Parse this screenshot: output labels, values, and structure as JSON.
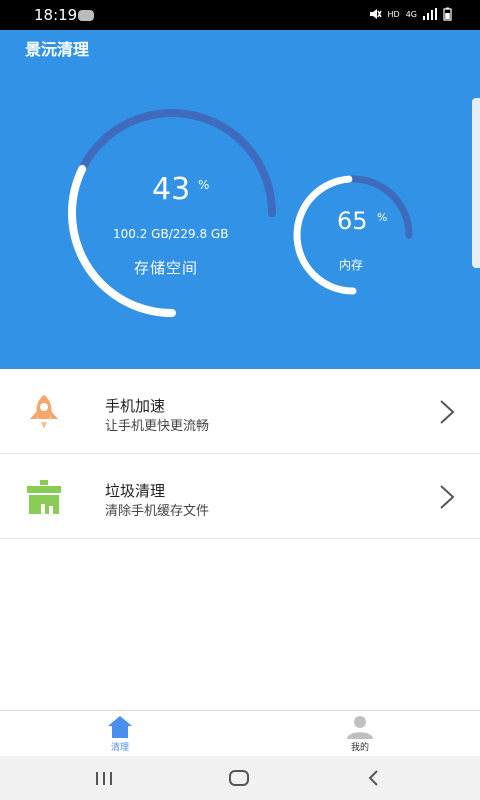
{
  "status_bar": {
    "time": "18:19",
    "network": "HD",
    "network_type": "4G"
  },
  "app": {
    "title": "景沅清理"
  },
  "storage": {
    "percent": 43,
    "percent_sign": "%",
    "size_text": "100.2 GB/229.8 GB",
    "label": "存储空间"
  },
  "memory": {
    "percent": 65,
    "percent_sign": "%",
    "label": "内存"
  },
  "features": [
    {
      "title": "手机加速",
      "subtitle": "让手机更快更流畅",
      "icon": "rocket-icon"
    },
    {
      "title": "垃圾清理",
      "subtitle": "清除手机缓存文件",
      "icon": "trash-bin-icon"
    }
  ],
  "tabs": [
    {
      "label": "清理",
      "icon": "home-icon",
      "active": true
    },
    {
      "label": "我的",
      "icon": "user-icon",
      "active": false
    }
  ],
  "colors": {
    "header_bg": "#3192e6",
    "gauge_track": "#3f6bbf",
    "active_tab": "#4a8ef0",
    "inactive_tab": "#c0c0c0"
  }
}
